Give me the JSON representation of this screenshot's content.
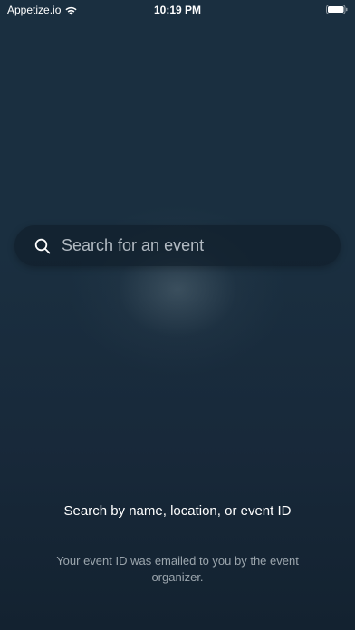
{
  "status_bar": {
    "carrier": "Appetize.io",
    "time": "10:19 PM",
    "wifi_icon": "wifi-icon",
    "battery_icon": "battery-icon"
  },
  "search": {
    "icon": "search-icon",
    "placeholder": "Search for an event",
    "value": ""
  },
  "help": {
    "heading": "Search by name, location, or event ID",
    "subtext": "Your event ID was emailed to you by the event organizer."
  },
  "colors": {
    "background_top": "#1a2f40",
    "background_bottom": "#132230",
    "search_bar": "#101f2b",
    "text_primary": "#ffffff",
    "text_secondary": "#c8d0d6"
  }
}
